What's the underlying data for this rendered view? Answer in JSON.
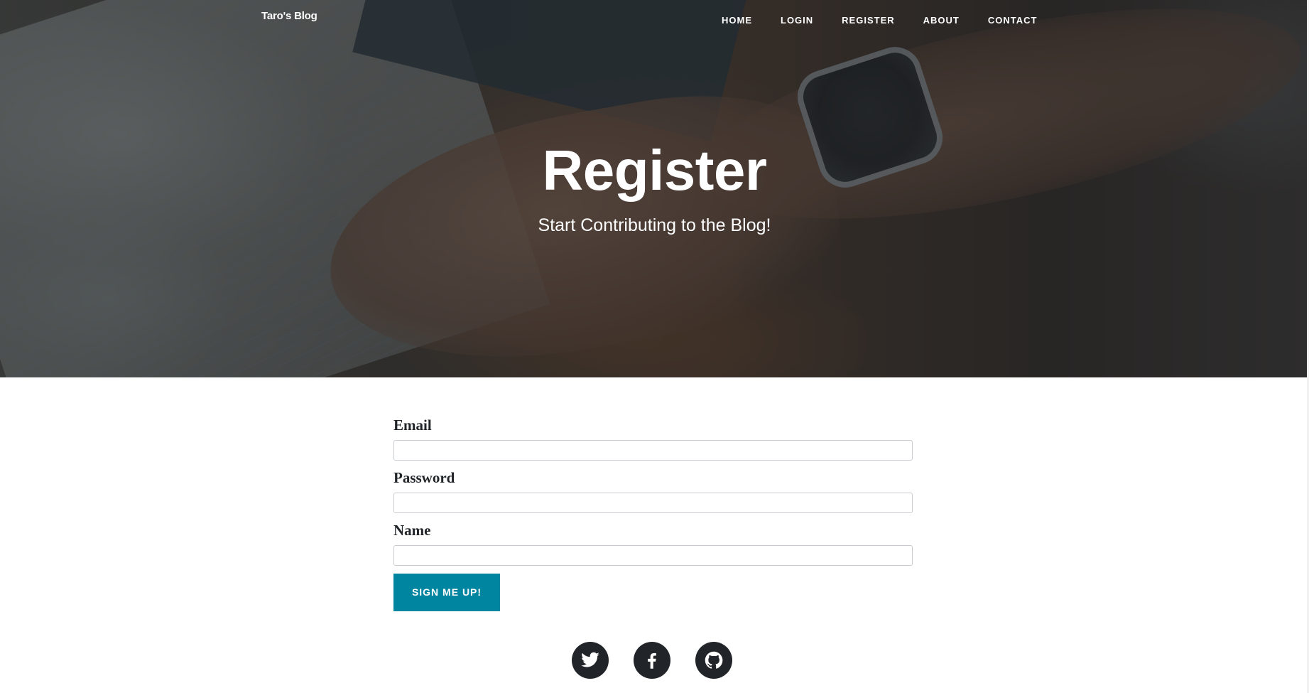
{
  "brand": {
    "name": "Taro's Blog"
  },
  "nav": {
    "items": [
      {
        "label": "HOME"
      },
      {
        "label": "LOGIN"
      },
      {
        "label": "REGISTER"
      },
      {
        "label": "ABOUT"
      },
      {
        "label": "CONTACT"
      }
    ]
  },
  "hero": {
    "heading": "Register",
    "subheading": "Start Contributing to the Blog!"
  },
  "form": {
    "email": {
      "label": "Email",
      "value": ""
    },
    "password": {
      "label": "Password",
      "value": ""
    },
    "name": {
      "label": "Name",
      "value": ""
    },
    "submit_label": "SIGN ME UP!"
  },
  "social": {
    "icons": [
      "twitter-icon",
      "facebook-icon",
      "github-icon"
    ]
  },
  "colors": {
    "accent": "#0085a1",
    "text": "#212529",
    "overlay": "#212529"
  }
}
